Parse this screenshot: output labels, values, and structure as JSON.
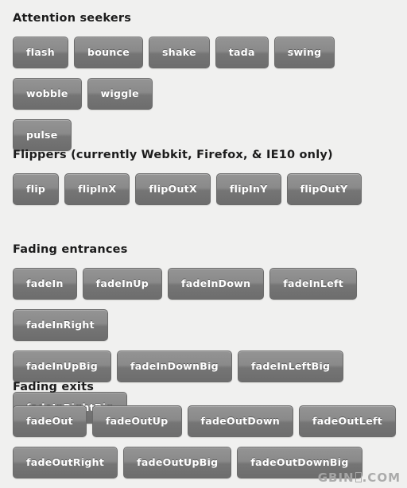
{
  "page": {
    "background_color": "#f0f0ef",
    "button_text_color": "#ffffff",
    "button_gradient_top": "#949494",
    "button_gradient_bottom": "#6d6d6d",
    "heading_color": "#1c1c1c"
  },
  "sections": [
    {
      "id": "attention-seekers",
      "title": "Attention seekers",
      "rows": [
        [
          "flash",
          "bounce",
          "shake",
          "tada",
          "swing",
          "wobble",
          "wiggle"
        ],
        [
          "pulse"
        ]
      ]
    },
    {
      "id": "flippers",
      "title": "Flippers (currently Webkit, Firefox, & IE10 only)",
      "rows": [
        [
          "flip",
          "flipInX",
          "flipOutX",
          "flipInY",
          "flipOutY"
        ]
      ]
    },
    {
      "id": "fading-entrances",
      "title": "Fading entrances",
      "rows": [
        [
          "fadeIn",
          "fadeInUp",
          "fadeInDown",
          "fadeInLeft",
          "fadeInRight"
        ],
        [
          "fadeInUpBig",
          "fadeInDownBig",
          "fadeInLeftBig",
          "fadeInRightBig"
        ]
      ]
    },
    {
      "id": "fading-exits",
      "title": "Fading exits",
      "rows": [
        [
          "fadeOut",
          "fadeOutUp",
          "fadeOutDown",
          "fadeOutLeft"
        ],
        [
          "fadeOutRight",
          "fadeOutUpBig",
          "fadeOutDownBig"
        ]
      ]
    }
  ],
  "watermark": {
    "prefix": "GBIN",
    "suffix": ".COM"
  }
}
